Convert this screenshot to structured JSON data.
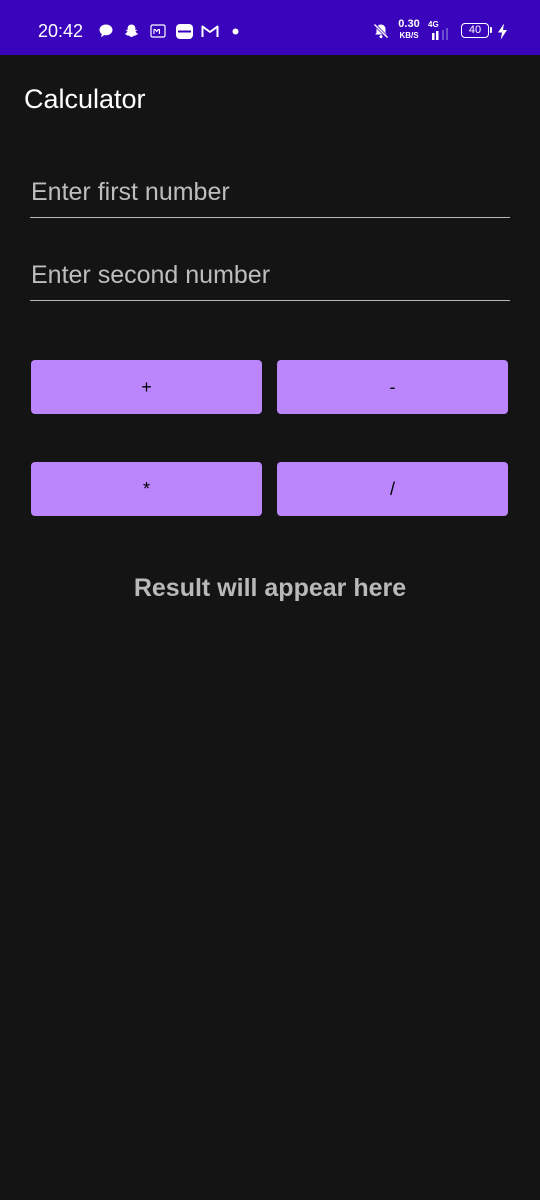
{
  "status_bar": {
    "time": "20:42",
    "net_speed_value": "0.30",
    "net_speed_unit": "KB/S",
    "network_type": "4G",
    "battery_level": "40",
    "notification_icons": [
      "message-icon",
      "snapchat-icon",
      "app-m-icon",
      "chat-app-icon",
      "gmail-icon",
      "dot-icon"
    ],
    "right_icons": [
      "do-not-disturb-icon",
      "signal-icon",
      "battery-icon",
      "charging-icon"
    ]
  },
  "app_bar": {
    "title": "Calculator"
  },
  "inputs": {
    "first_placeholder": "Enter first number",
    "first_value": "",
    "second_placeholder": "Enter second number",
    "second_value": ""
  },
  "buttons": {
    "add_label": "+",
    "subtract_label": "-",
    "multiply_label": "*",
    "divide_label": "/"
  },
  "result": {
    "text": "Result will appear here"
  },
  "colors": {
    "status_bar": "#3a04bd",
    "background": "#141414",
    "button": "#bb86fc",
    "result_text": "#b9b9b9"
  }
}
